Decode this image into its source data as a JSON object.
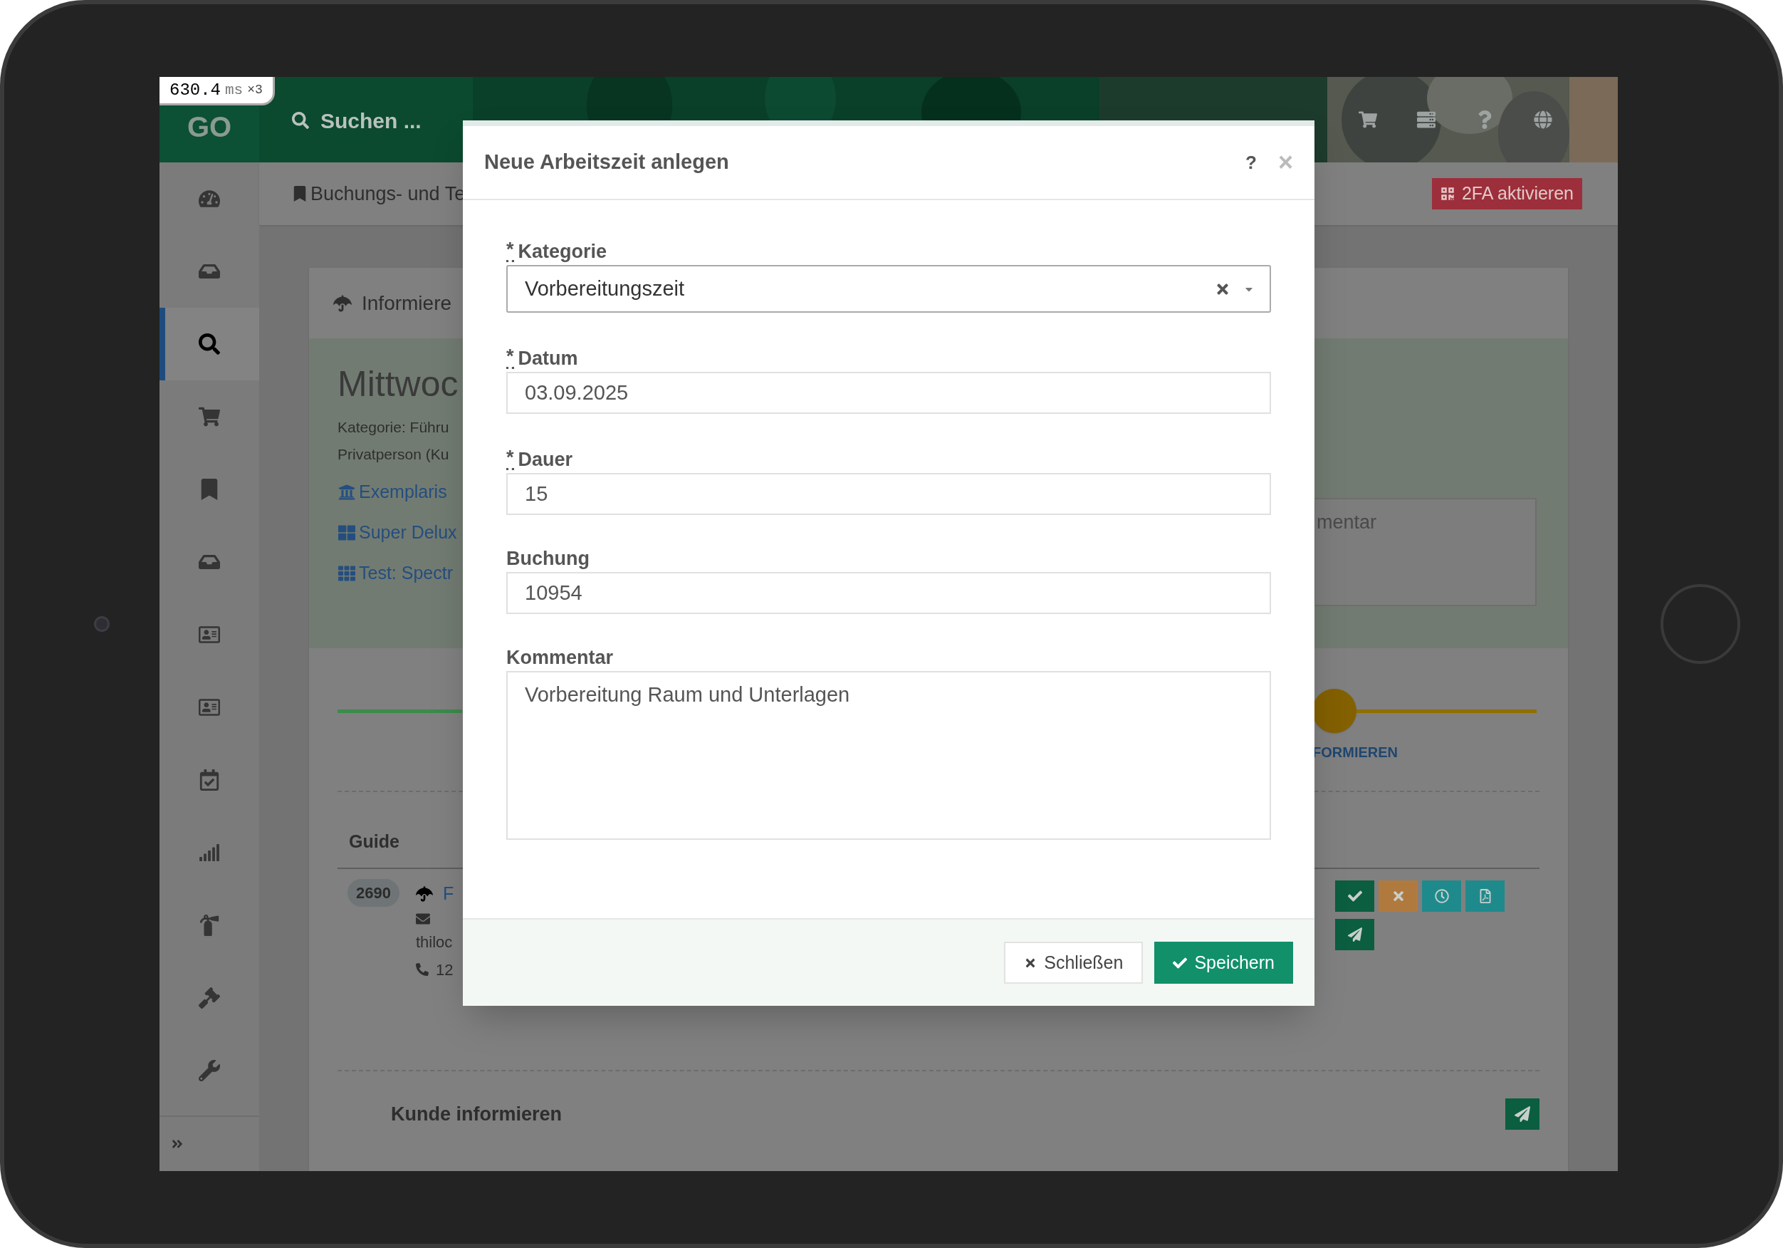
{
  "perf_badge": {
    "value": "630.4",
    "unit": "ms",
    "count": "×3"
  },
  "topbar": {
    "logo": "GO",
    "search_label": "Suchen ...",
    "icons": [
      {
        "kind": "cart"
      },
      {
        "kind": "server"
      },
      {
        "kind": "help"
      },
      {
        "kind": "language"
      }
    ]
  },
  "sidebar": {
    "items": [
      {
        "kind": "dashboard",
        "selected": false
      },
      {
        "kind": "inbox",
        "selected": false
      },
      {
        "kind": "search",
        "selected": true
      },
      {
        "kind": "cart",
        "selected": false
      },
      {
        "kind": "bookmark",
        "selected": false
      },
      {
        "kind": "inbox",
        "selected": false
      },
      {
        "kind": "contact",
        "selected": false
      },
      {
        "kind": "contact",
        "selected": false
      },
      {
        "kind": "calendar",
        "selected": false
      },
      {
        "kind": "stats",
        "selected": false
      },
      {
        "kind": "extinguisher",
        "selected": false
      },
      {
        "kind": "gavel",
        "selected": false
      },
      {
        "kind": "wrench",
        "selected": false
      }
    ]
  },
  "breadcrumb": "Buchungs- und Te",
  "twofa_button": "2FA aktivieren",
  "card": {
    "header": "Informiere",
    "title": "Mittwoc",
    "lines": [
      "Kategorie: Führu",
      "Privatperson (Ku"
    ],
    "links": [
      {
        "kind": "institution",
        "text": "Exemplaris"
      },
      {
        "kind": "grid-large",
        "text": "Super Delux"
      },
      {
        "kind": "grid-small",
        "text": "Test: Spectr"
      }
    ],
    "comment_placeholder": "mentar",
    "step_label": "FORMIEREN",
    "table": {
      "column_1": "Guide",
      "row": {
        "badge": "2690",
        "name": "F",
        "email": "thiloc",
        "phone": "12"
      }
    },
    "actions": [
      {
        "kind": "confirm"
      },
      {
        "kind": "cancel"
      },
      {
        "kind": "time"
      },
      {
        "kind": "pdf"
      },
      {
        "kind": "send"
      }
    ],
    "notify_title": "Kunde informieren"
  },
  "modal": {
    "title": "Neue Arbeitszeit anlegen",
    "help": "?",
    "close": "×",
    "required_mark": "*",
    "fields": [
      {
        "kind": "select",
        "label": "Kategorie",
        "required": true,
        "value": "Vorbereitungszeit"
      },
      {
        "kind": "input",
        "label": "Datum",
        "required": true,
        "value": "03.09.2025"
      },
      {
        "kind": "input",
        "label": "Dauer",
        "required": true,
        "value": "15"
      },
      {
        "kind": "input",
        "label": "Buchung",
        "required": false,
        "value": "10954"
      },
      {
        "kind": "textarea",
        "label": "Kommentar",
        "required": false,
        "value": "Vorbereitung Raum und Unterlagen"
      }
    ],
    "buttons": [
      {
        "kind": "secondary",
        "label": "Schließen"
      },
      {
        "kind": "primary",
        "label": "Speichern"
      }
    ]
  }
}
